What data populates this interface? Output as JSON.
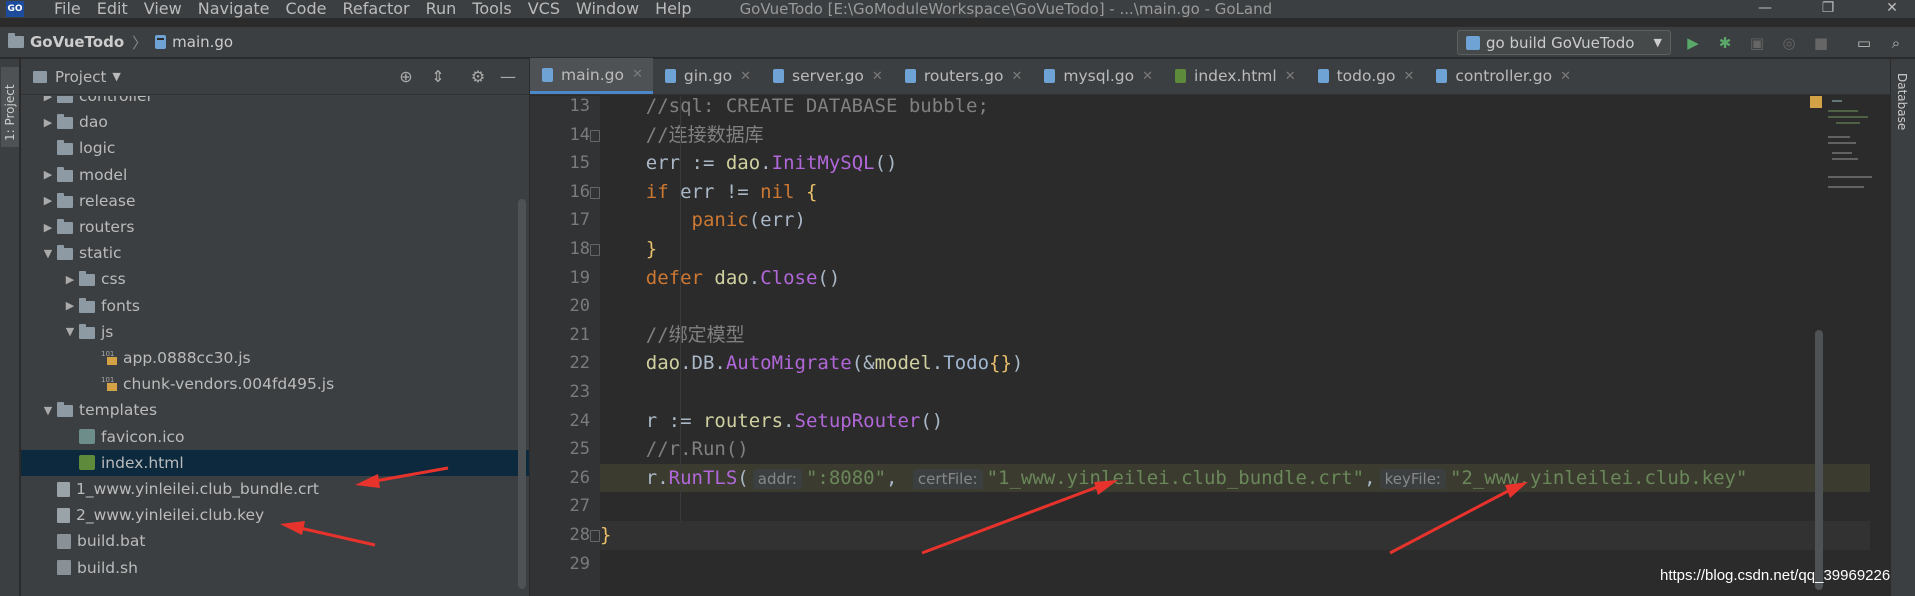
{
  "menu": {
    "logo": "GO",
    "items": [
      "File",
      "Edit",
      "View",
      "Navigate",
      "Code",
      "Refactor",
      "Run",
      "Tools",
      "VCS",
      "Window",
      "Help"
    ],
    "window_title": "GoVueTodo [E:\\GoModuleWorkspace\\GoVueTodo] - ...\\main.go - GoLand"
  },
  "navbar": {
    "project": "GoVueTodo",
    "file": "main.go",
    "run_config": "go build GoVueTodo"
  },
  "left_strip": {
    "project_label": "1: Project"
  },
  "right_strip": {
    "database_label": "Database"
  },
  "project_panel": {
    "title": "Project",
    "tree": [
      {
        "label": "controller",
        "depth": 1,
        "type": "folder",
        "expand": "collapsed"
      },
      {
        "label": "dao",
        "depth": 1,
        "type": "folder",
        "expand": "collapsed"
      },
      {
        "label": "logic",
        "depth": 1,
        "type": "folder",
        "expand": "none"
      },
      {
        "label": "model",
        "depth": 1,
        "type": "folder",
        "expand": "collapsed"
      },
      {
        "label": "release",
        "depth": 1,
        "type": "folder",
        "expand": "collapsed"
      },
      {
        "label": "routers",
        "depth": 1,
        "type": "folder",
        "expand": "collapsed"
      },
      {
        "label": "static",
        "depth": 1,
        "type": "folder",
        "expand": "expanded"
      },
      {
        "label": "css",
        "depth": 2,
        "type": "folder",
        "expand": "collapsed"
      },
      {
        "label": "fonts",
        "depth": 2,
        "type": "folder",
        "expand": "collapsed"
      },
      {
        "label": "js",
        "depth": 2,
        "type": "folder",
        "expand": "expanded"
      },
      {
        "label": "app.0888cc30.js",
        "depth": 3,
        "type": "js",
        "expand": "none"
      },
      {
        "label": "chunk-vendors.004fd495.js",
        "depth": 3,
        "type": "js",
        "expand": "none"
      },
      {
        "label": "templates",
        "depth": 1,
        "type": "folder",
        "expand": "expanded"
      },
      {
        "label": "favicon.ico",
        "depth": 2,
        "type": "ico",
        "expand": "none"
      },
      {
        "label": "index.html",
        "depth": 2,
        "type": "html",
        "expand": "none",
        "selected": true
      },
      {
        "label": "1_www.yinleilei.club_bundle.crt",
        "depth": 1,
        "type": "doc",
        "expand": "none"
      },
      {
        "label": "2_www.yinleilei.club.key",
        "depth": 1,
        "type": "key",
        "expand": "none"
      },
      {
        "label": "build.bat",
        "depth": 1,
        "type": "bat",
        "expand": "none"
      },
      {
        "label": "build.sh",
        "depth": 1,
        "type": "sh",
        "expand": "none"
      }
    ]
  },
  "tabs": [
    {
      "label": "main.go",
      "kind": "go",
      "active": true
    },
    {
      "label": "gin.go",
      "kind": "go"
    },
    {
      "label": "server.go",
      "kind": "go"
    },
    {
      "label": "routers.go",
      "kind": "go"
    },
    {
      "label": "mysql.go",
      "kind": "go"
    },
    {
      "label": "index.html",
      "kind": "html"
    },
    {
      "label": "todo.go",
      "kind": "go"
    },
    {
      "label": "controller.go",
      "kind": "go"
    }
  ],
  "editor": {
    "lines": [
      {
        "n": "13",
        "indent": 1,
        "tokens": [
          [
            "c-com",
            "//sql: CREATE DATABASE bubble;"
          ]
        ]
      },
      {
        "n": "14",
        "indent": 1,
        "tokens": [
          [
            "c-com",
            "//连接数据库"
          ]
        ]
      },
      {
        "n": "15",
        "indent": 1,
        "tokens": [
          [
            "",
            "err := "
          ],
          [
            "c-pkg",
            "dao"
          ],
          [
            "",
            "."
          ],
          [
            "c-fn",
            "InitMySQL"
          ],
          [
            "",
            "()"
          ]
        ]
      },
      {
        "n": "16",
        "indent": 1,
        "tokens": [
          [
            "c-kw",
            "if"
          ],
          [
            "",
            " err != "
          ],
          [
            "c-kw",
            "nil"
          ],
          [
            "",
            " "
          ],
          [
            "c-br",
            "{"
          ]
        ]
      },
      {
        "n": "17",
        "indent": 2,
        "tokens": [
          [
            "c-panic",
            "panic"
          ],
          [
            "",
            "(err)"
          ]
        ]
      },
      {
        "n": "18",
        "indent": 1,
        "tokens": [
          [
            "c-br",
            "}"
          ]
        ]
      },
      {
        "n": "19",
        "indent": 1,
        "tokens": [
          [
            "c-kw",
            "defer"
          ],
          [
            "",
            " "
          ],
          [
            "c-pkg",
            "dao"
          ],
          [
            "",
            "."
          ],
          [
            "c-fn",
            "Close"
          ],
          [
            "",
            "()"
          ]
        ]
      },
      {
        "n": "20",
        "indent": 1,
        "tokens": []
      },
      {
        "n": "21",
        "indent": 1,
        "tokens": [
          [
            "c-com",
            "//绑定模型"
          ]
        ]
      },
      {
        "n": "22",
        "indent": 1,
        "tokens": [
          [
            "c-pkg",
            "dao"
          ],
          [
            "",
            ".DB."
          ],
          [
            "c-fn",
            "AutoMigrate"
          ],
          [
            "",
            "(&"
          ],
          [
            "c-pkg",
            "model"
          ],
          [
            "",
            "."
          ],
          [
            "c-type",
            "Todo"
          ],
          [
            "c-br",
            "{}"
          ],
          [
            "",
            ")"
          ]
        ]
      },
      {
        "n": "23",
        "indent": 1,
        "tokens": []
      },
      {
        "n": "24",
        "indent": 1,
        "tokens": [
          [
            "",
            "r := "
          ],
          [
            "c-pkg",
            "routers"
          ],
          [
            "",
            "."
          ],
          [
            "c-fn",
            "SetupRouter"
          ],
          [
            "",
            "()"
          ]
        ]
      },
      {
        "n": "25",
        "indent": 1,
        "tokens": [
          [
            "c-com",
            "//r.Run()"
          ]
        ]
      },
      {
        "n": "26",
        "indent": 1,
        "tokens": [
          [
            "",
            "r."
          ],
          [
            "c-fn",
            "RunTLS"
          ],
          [
            "",
            "("
          ],
          [
            "c-hint",
            "addr:"
          ],
          [
            "c-str",
            "\":8080\""
          ],
          [
            "",
            ", "
          ],
          [
            "c-hint",
            "certFile:"
          ],
          [
            "c-str",
            "\"1_www.yinleilei.club_bundle.crt\""
          ],
          [
            "",
            ","
          ],
          [
            "c-hint",
            "keyFile:"
          ],
          [
            "c-str",
            "\"2_www.yinleilei.club.key\""
          ]
        ]
      },
      {
        "n": "27",
        "indent": 0,
        "tokens": []
      },
      {
        "n": "28",
        "indent": 0,
        "tokens": [
          [
            "c-br",
            "}"
          ]
        ]
      },
      {
        "n": "29",
        "indent": 0,
        "tokens": []
      }
    ]
  },
  "watermark": "https://blog.csdn.net/qq_39969226",
  "colors": {
    "accent": "#4a88c7",
    "annotation_arrow": "#e8322c"
  }
}
